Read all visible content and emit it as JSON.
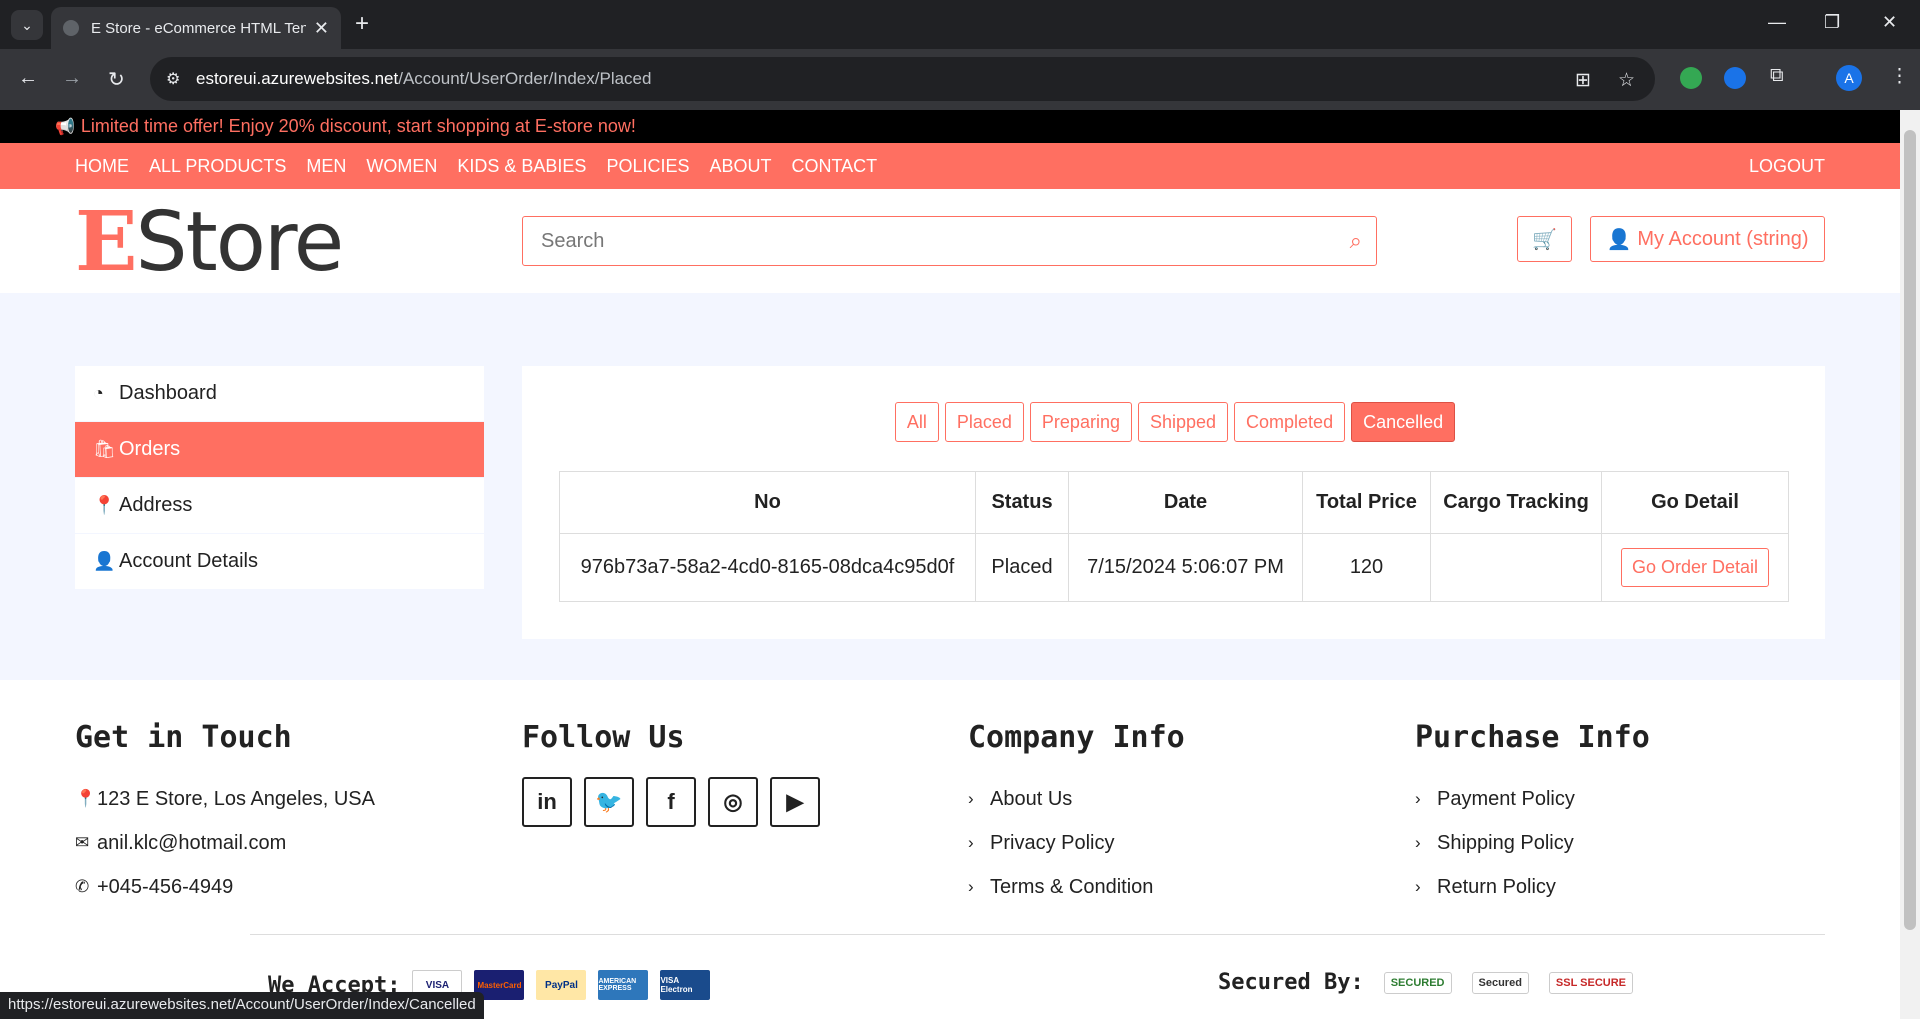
{
  "browser": {
    "tab_title": "E Store - eCommerce HTML Ten",
    "url_host": "estoreui.azurewebsites.net",
    "url_path": "/Account/UserOrder/Index/Placed",
    "profile_initial": "A",
    "status_url": "https://estoreui.azurewebsites.net/Account/UserOrder/Index/Cancelled"
  },
  "promo": {
    "text": "Limited time offer! Enjoy 20% discount, start shopping at E-store now!"
  },
  "nav": {
    "items": [
      "HOME",
      "ALL PRODUCTS",
      "MEN",
      "WOMEN",
      "KIDS & BABIES",
      "POLICIES",
      "ABOUT",
      "CONTACT"
    ],
    "logout": "LOGOUT"
  },
  "header": {
    "logo_e": "E",
    "logo_rest": "Store",
    "search_placeholder": "Search",
    "account_label": "My Account (string)"
  },
  "sidebar": {
    "items": [
      {
        "label": "Dashboard",
        "icon": "tachometer-icon"
      },
      {
        "label": "Orders",
        "icon": "shopping-bag-icon",
        "active": true
      },
      {
        "label": "Address",
        "icon": "map-marker-icon"
      },
      {
        "label": "Account Details",
        "icon": "user-icon"
      }
    ]
  },
  "orders": {
    "filters": [
      "All",
      "Placed",
      "Preparing",
      "Shipped",
      "Completed",
      "Cancelled"
    ],
    "active_filter": "Cancelled",
    "columns": [
      "No",
      "Status",
      "Date",
      "Total Price",
      "Cargo Tracking",
      "Go Detail"
    ],
    "rows": [
      {
        "no": "976b73a7-58a2-4cd0-8165-08dca4c95d0f",
        "status": "Placed",
        "date": "7/15/2024 5:06:07 PM",
        "total": "120",
        "cargo": "",
        "action": "Go Order Detail"
      }
    ]
  },
  "footer": {
    "touch": {
      "title": "Get in Touch",
      "address": "123 E Store, Los Angeles, USA",
      "email": "anil.klc@hotmail.com",
      "phone": "+045-456-4949"
    },
    "follow": {
      "title": "Follow Us"
    },
    "company": {
      "title": "Company Info",
      "links": [
        "About Us",
        "Privacy Policy",
        "Terms & Condition"
      ]
    },
    "purchase": {
      "title": "Purchase Info",
      "links": [
        "Payment Policy",
        "Shipping Policy",
        "Return Policy"
      ]
    },
    "we_accept": "We Accept:",
    "cards": [
      "VISA",
      "MasterCard",
      "PayPal",
      "AMERICAN EXPRESS",
      "VISA Electron"
    ],
    "secured_by": "Secured By:",
    "seals": [
      "SECURED",
      "Secured",
      "SSL SECURE"
    ]
  },
  "colors": {
    "accent": "#ff6f61",
    "dark": "#000000",
    "panel_bg": "#f3f6ff"
  }
}
